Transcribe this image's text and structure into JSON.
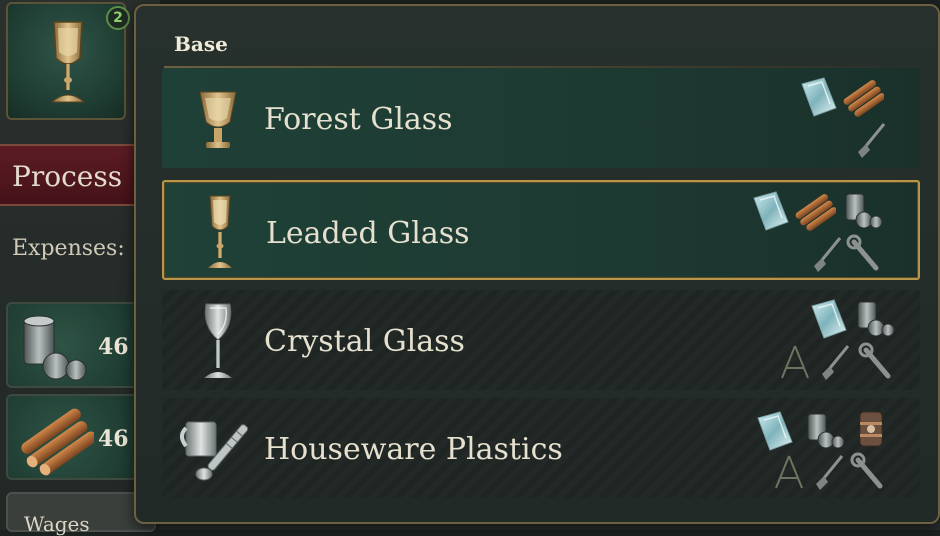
{
  "building": {
    "badge_count": "2",
    "icon": "wine-glass-icon"
  },
  "sidebar": {
    "process_tab_label": "Process",
    "expenses_label": "Expenses:",
    "expense_items": [
      {
        "icon": "iron-ingots-icon",
        "value": "46"
      },
      {
        "icon": "wood-logs-icon",
        "value": "46"
      }
    ],
    "wages_label": "Wages"
  },
  "popup": {
    "title": "Base",
    "options": [
      {
        "label": "Forest Glass",
        "icon": "glass-goblet-icon",
        "selected": false,
        "inputs": [
          "glass-icon",
          "wood-icon",
          "shovel-icon"
        ]
      },
      {
        "label": "Leaded Glass",
        "icon": "wine-glass-icon",
        "selected": true,
        "inputs": [
          "glass-icon",
          "wood-icon",
          "lead-icon",
          "shovel-icon",
          "wrench-icon"
        ]
      },
      {
        "label": "Crystal Glass",
        "icon": "crystal-wine-glass-icon",
        "selected": false,
        "inputs": [
          "glass-icon",
          "lead-icon",
          "compass-icon",
          "shovel-icon",
          "wrench-icon"
        ]
      },
      {
        "label": "Houseware Plastics",
        "icon": "mug-spoon-icon",
        "selected": false,
        "inputs": [
          "glass-icon",
          "lead-icon",
          "oil-drum-icon",
          "compass-icon",
          "shovel-icon",
          "wrench-icon"
        ]
      }
    ]
  },
  "colors": {
    "accent_gold": "#b7964b",
    "selected_bg": "#1f4137",
    "process_tab": "#5c1c24"
  }
}
